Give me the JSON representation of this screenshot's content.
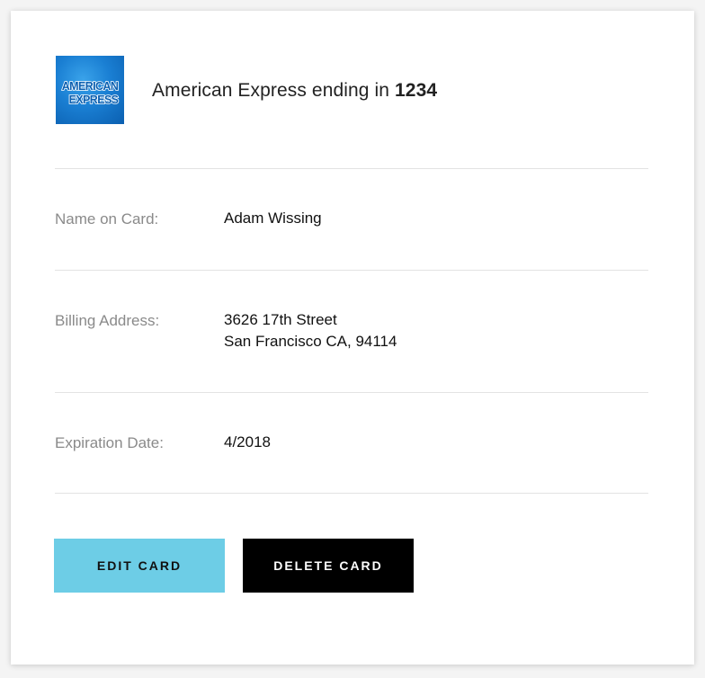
{
  "card": {
    "logo_text_line1": "AMERICAN",
    "logo_text_line2": "EXPRESS",
    "title_prefix": "American Express ending in",
    "last_four": "1234",
    "brand_color": "#1a7fd3"
  },
  "details": {
    "name_label": "Name on Card:",
    "name_value": "Adam Wissing",
    "address_label": "Billing Address:",
    "address_line1": "3626 17th Street",
    "address_line2": "San Francisco CA, 94114",
    "expiration_label": "Expiration Date:",
    "expiration_value": "4/2018"
  },
  "actions": {
    "edit_label": "EDIT CARD",
    "delete_label": "DELETE CARD",
    "edit_color": "#6dcde6",
    "delete_color": "#000000"
  }
}
